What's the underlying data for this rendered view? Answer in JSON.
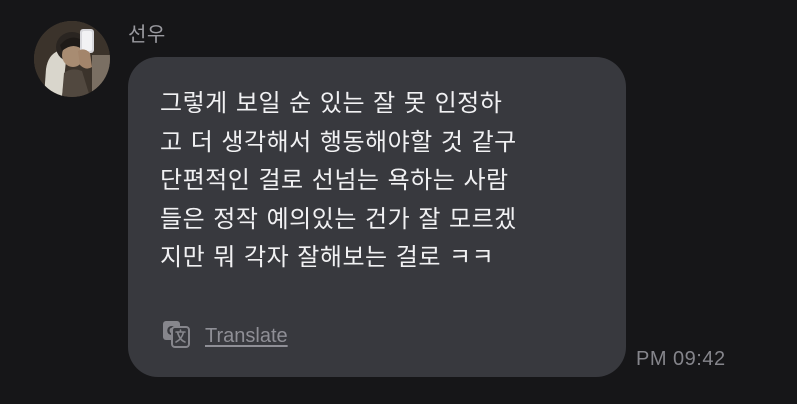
{
  "message": {
    "sender_name": "선우",
    "avatar_icon": "profile-photo",
    "text": "그렇게 보일 순 있는 잘 못 인정하\n고 더 생각해서 행동해야할 것 같구\n단편적인 걸로 선넘는 욕하는 사람\n들은 정작 예의있는 건가 잘 모르겠\n지만 뭐 각자 잘해보는 걸로 ㅋㅋ",
    "translate_icon": "translate-icon",
    "translate_label": "Translate",
    "timestamp": "PM 09:42"
  },
  "colors": {
    "background": "#161618",
    "bubble": "#38393e",
    "text": "#f1f1f3",
    "muted": "#8f8f96"
  }
}
